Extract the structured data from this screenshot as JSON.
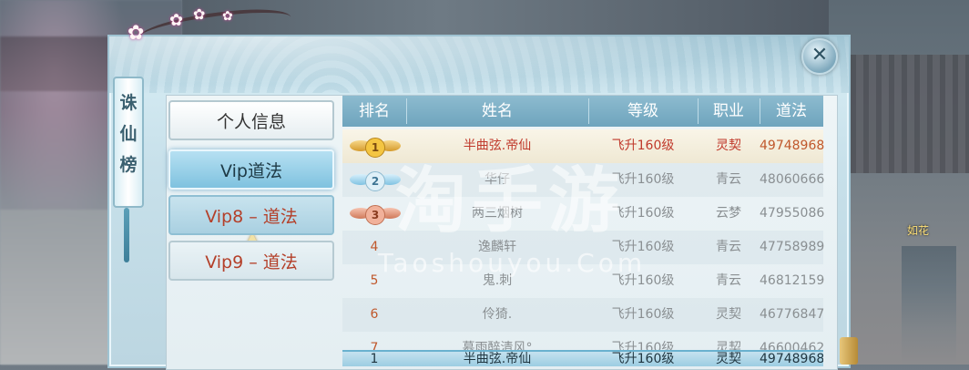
{
  "title": "诛仙榜",
  "close_icon": "close-icon",
  "menu": {
    "items": [
      {
        "label": "个人信息",
        "state": "normal"
      },
      {
        "label": "Vip道法",
        "state": "active"
      },
      {
        "label": "Vip8 – 道法",
        "state": "selected"
      },
      {
        "label": "Vip9 – 道法",
        "state": "normal"
      }
    ]
  },
  "table": {
    "headers": [
      "排名",
      "姓名",
      "等级",
      "职业",
      "道法"
    ],
    "rows": [
      {
        "rank": "1",
        "name": "半曲弦.帝仙",
        "level": "飞升160级",
        "job": "灵契",
        "score": "49748968",
        "medal": "gold"
      },
      {
        "rank": "2",
        "name": "华仔",
        "level": "飞升160级",
        "job": "青云",
        "score": "48060666",
        "medal": "silver"
      },
      {
        "rank": "3",
        "name": "两三烟树",
        "level": "飞升160级",
        "job": "云梦",
        "score": "47955086",
        "medal": "bronze"
      },
      {
        "rank": "4",
        "name": "逸麟轩",
        "level": "飞升160级",
        "job": "青云",
        "score": "47758989"
      },
      {
        "rank": "5",
        "name": "鬼.刺",
        "level": "飞升160级",
        "job": "青云",
        "score": "46812159"
      },
      {
        "rank": "6",
        "name": "伶猗.",
        "level": "飞升160级",
        "job": "灵契",
        "score": "46776847"
      },
      {
        "rank": "7",
        "name": "慕雨醉清风°",
        "level": "飞升160级",
        "job": "灵契",
        "score": "46600462"
      }
    ],
    "my_row": {
      "rank": "1",
      "name": "半曲弦.帝仙",
      "level": "飞升160级",
      "job": "灵契",
      "score": "49748968"
    }
  },
  "npc_name": "如花",
  "watermark": {
    "main": "淘手游",
    "sub": "Taoshouyou.Com"
  },
  "colors": {
    "accent": "#7fc2df",
    "highlight_text": "#c0392b",
    "header_bar": "#7aaec6"
  }
}
